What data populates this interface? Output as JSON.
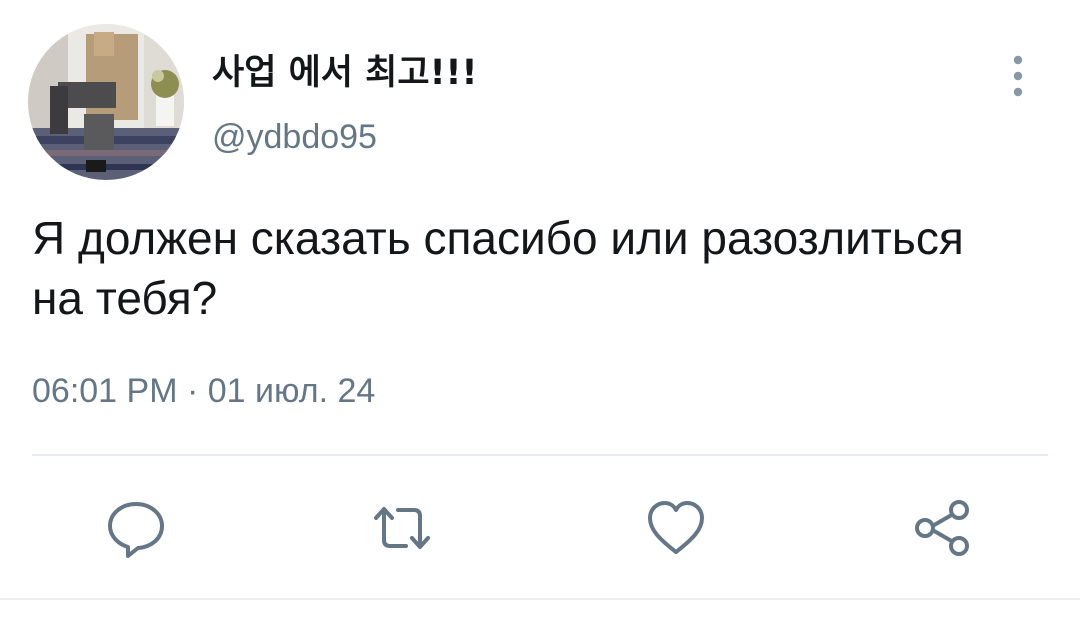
{
  "tweet": {
    "display_name": "사업 에서 최고!!!",
    "handle": "@ydbdo95",
    "text": "Я должен сказать спасибо или разозлиться на тебя?",
    "timestamp": "06:01 PM · 01 июл. 24"
  },
  "icons": {
    "more": "vertical-dots-icon",
    "reply": "speech-bubble-icon",
    "retweet": "retweet-arrows-icon",
    "like": "heart-outline-icon",
    "share": "share-nodes-icon"
  },
  "colors": {
    "text": "#14171a",
    "secondary": "#657786",
    "divider": "#e6ecf0"
  }
}
